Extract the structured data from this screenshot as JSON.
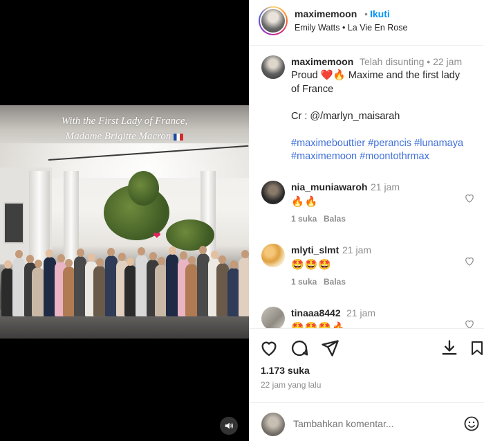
{
  "media": {
    "caption_line1": "With the First Lady of France,",
    "caption_line2": "Madame Brigitte Macron",
    "sound_icon": "speaker-icon"
  },
  "header": {
    "username": "maximemoon",
    "separator": "•",
    "follow_label": "Ikuti",
    "audio_text": "Emily Watts • La Vie En Rose"
  },
  "caption": {
    "username": "maximemoon",
    "meta": "Telah disunting • 22 jam",
    "line1_prefix": "Proud",
    "line1_suffix": "Maxime and the first lady",
    "line2": "of France",
    "line3": "Cr : @/marlyn_maisarah",
    "hashtags_line1": [
      "#maximebouttier",
      "#perancis",
      "#lunamaya"
    ],
    "hashtags_line2": [
      "#maximemoon",
      "#moontothrmax"
    ]
  },
  "comments": [
    {
      "username": "nia_muniawaroh",
      "time": "21 jam",
      "text": "🔥🔥",
      "likes": "1 suka",
      "reply": "Balas"
    },
    {
      "username": "mlyti_slmt",
      "time": "21 jam",
      "text": "🤩🤩🤩",
      "likes": "1 suka",
      "reply": "Balas"
    },
    {
      "username": "tinaaa8442",
      "time": "21 jam",
      "text": "🤩🤩🤩🔥",
      "likes": "",
      "reply": ""
    }
  ],
  "actions": {
    "likes_count": "1.173 suka",
    "post_time": "22 jam yang lalu",
    "comment_placeholder": "Tambahkan komentar..."
  },
  "colors": {
    "follow_blue": "#0095f6",
    "hashtag_blue": "#3f6fd8",
    "muted_text": "#8e8e8e"
  }
}
